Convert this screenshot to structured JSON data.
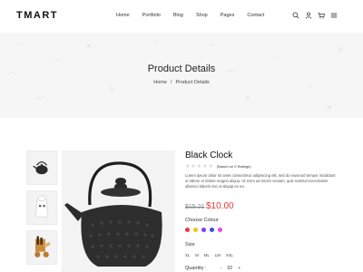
{
  "header": {
    "logo": "TMART",
    "nav": [
      "Home",
      "Portfolio",
      "Blog",
      "Shop",
      "Pages",
      "Contact"
    ],
    "icons": [
      "search-icon",
      "user-icon",
      "cart-icon",
      "menu-icon"
    ]
  },
  "banner": {
    "title": "Product Details",
    "breadcrumb": [
      "Home",
      "/",
      "Product Details"
    ]
  },
  "gallery": {
    "thumbnails": [
      "teapot-thumbnail",
      "figurine-thumbnail",
      "cart-toy-thumbnail"
    ],
    "main_image": "cast-iron-teapot"
  },
  "product": {
    "title": "Black Clock",
    "rating_text": "(Based on 0 Ratings)",
    "rating": 0,
    "rating_max": 5,
    "description": "Lorem ipsum dolor sit amet consectetur adipisicing elit, sed do eiusmod tempor incididunt ut labore et dolore magna aliqua. Ut enim ad minim veniam, quis nostrud exercitation ullamco laboris nisi ut aliquip ex ea.",
    "old_price": "$15.21",
    "new_price": "$10.00",
    "color_label": "Choose Colour",
    "colors": [
      "#e83b3b",
      "#f0c419",
      "#7b3ff2",
      "#3b4fe8",
      "#e84bd3"
    ],
    "size_label": "Size",
    "sizes": [
      "XL",
      "M",
      "ML",
      "LM",
      "XXL"
    ],
    "quantity_label": "Quantity :",
    "quantity_minus": "-",
    "quantity_value": "02",
    "quantity_plus": "+"
  },
  "colors": {
    "accent": "#e83b3b",
    "banner_bg": "#f6f6f6"
  }
}
